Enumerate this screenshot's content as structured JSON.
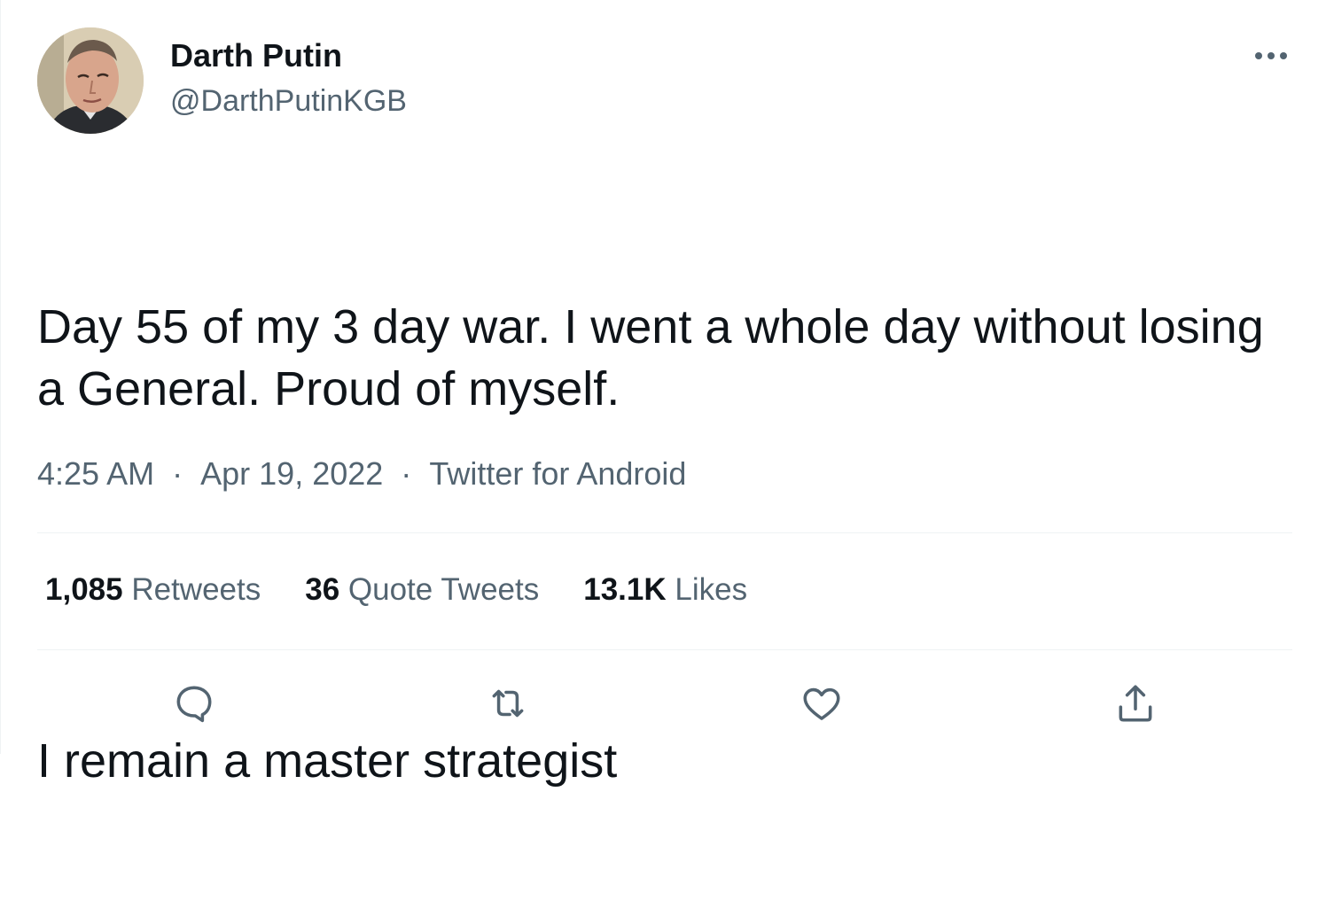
{
  "author": {
    "display_name": "Darth Putin",
    "handle": "@DarthPutinKGB",
    "avatar_icon": "avatar-photo"
  },
  "tweet": {
    "paragraphs": [
      "Day 55 of my 3 day war. I went a whole day without losing a General. Proud of myself.",
      "I remain a master strategist"
    ],
    "time": "4:25 AM",
    "separator": "·",
    "date": "Apr 19, 2022",
    "source": "Twitter for Android"
  },
  "stats": {
    "retweets": {
      "count": "1,085",
      "label": "Retweets"
    },
    "quote_tweets": {
      "count": "36",
      "label": "Quote Tweets"
    },
    "likes": {
      "count": "13.1K",
      "label": "Likes"
    }
  },
  "actions": [
    "reply-icon",
    "retweet-icon",
    "like-icon",
    "share-icon"
  ],
  "colors": {
    "text": "#0f1419",
    "secondary": "#536471",
    "divider": "#eff3f4"
  }
}
